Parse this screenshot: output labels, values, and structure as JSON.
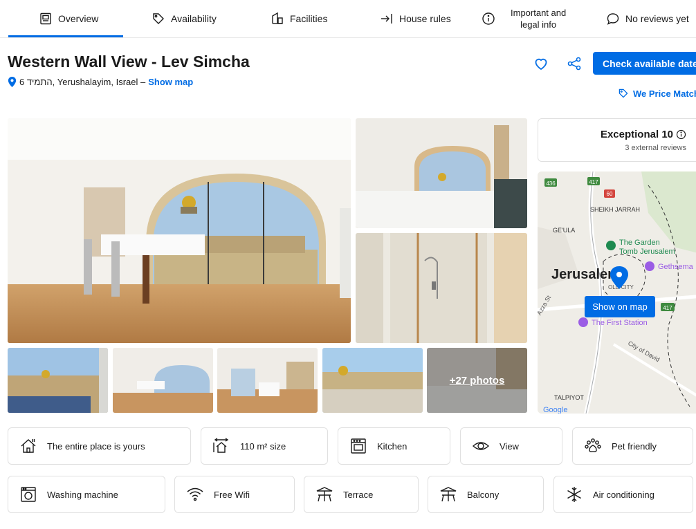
{
  "nav": {
    "overview": "Overview",
    "availability": "Availability",
    "facilities": "Facilities",
    "house_rules": "House rules",
    "legal_line1": "Important and",
    "legal_line2": "legal info",
    "reviews": "No reviews yet"
  },
  "property": {
    "title": "Western Wall View - Lev Simcha",
    "address": "6 התמיד, Yerushalayim, Israel – ",
    "show_map": "Show map"
  },
  "actions": {
    "check_dates": "Check available dates",
    "price_match": "We Price Match"
  },
  "gallery": {
    "more_photos": "+27 photos"
  },
  "review_score": {
    "label": "Exceptional 10",
    "sub": "3 external reviews"
  },
  "map": {
    "button": "Show on map",
    "labels": {
      "sheikh": "SHEIKH JARRAH",
      "geula": "GE'ULA",
      "garden1": "The Garden",
      "garden2": "Tomb Jerusalem",
      "gethsemane": "Gethsema",
      "jerusalem": "Jerusalem",
      "old_city": "OLD CITY",
      "first_station": "The First Station",
      "city_david": "City of David",
      "talpiyot": "TALPIYOT",
      "street": "Azza St",
      "google": "Google",
      "r417a": "417",
      "r436": "436",
      "r417b": "417",
      "r60": "60"
    }
  },
  "facilities": {
    "entire_place": "The entire place is yours",
    "size": "110 m² size",
    "kitchen": "Kitchen",
    "view": "View",
    "pets": "Pet friendly",
    "washer": "Washing machine",
    "wifi": "Free Wifi",
    "terrace": "Terrace",
    "balcony": "Balcony",
    "aircon": "Air conditioning"
  },
  "colors": {
    "accent": "#006ce4",
    "text": "#1a1a1a",
    "border": "#e0e0e0"
  }
}
